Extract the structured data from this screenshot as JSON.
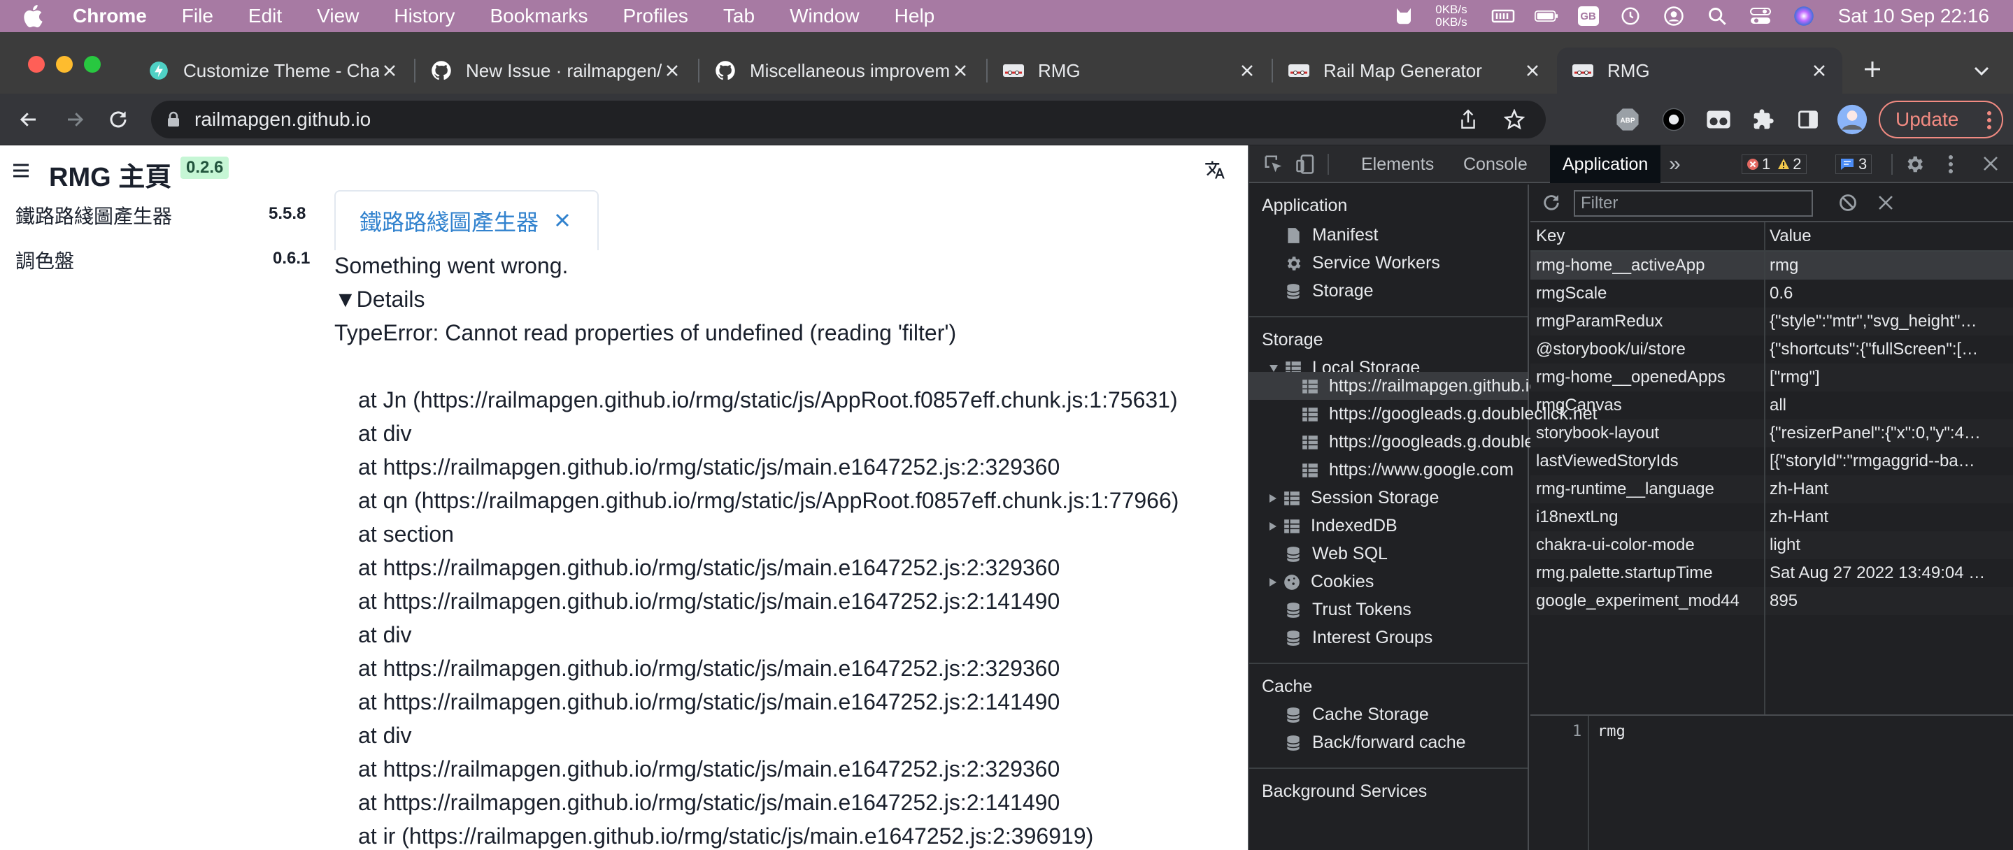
{
  "menubar": {
    "app": "Chrome",
    "items": [
      "File",
      "Edit",
      "View",
      "History",
      "Bookmarks",
      "Profiles",
      "Tab",
      "Window",
      "Help"
    ],
    "net_up": "0KB/s",
    "net_down": "0KB/s",
    "input_source": "GB",
    "clock": "Sat 10 Sep  22:16"
  },
  "tabs": [
    {
      "title": "Customize Theme - Chakra",
      "favicon": "chakra-icon"
    },
    {
      "title": "New Issue · railmapgen/rmg",
      "favicon": "github-icon"
    },
    {
      "title": "Miscellaneous improvements",
      "favicon": "github-icon"
    },
    {
      "title": "RMG",
      "favicon": "rmg-icon"
    },
    {
      "title": "Rail Map Generator",
      "favicon": "rmg-icon"
    },
    {
      "title": "RMG",
      "favicon": "rmg-icon"
    }
  ],
  "toolbar": {
    "url": "railmapgen.github.io",
    "update_label": "Update"
  },
  "app": {
    "title": "RMG 主頁",
    "version": "0.2.6",
    "nav": [
      {
        "label": "鐵路路綫圖產生器",
        "version": "5.5.8"
      },
      {
        "label": "調色盤",
        "version": "0.6.1"
      }
    ],
    "open_tab": "鐵路路綫圖產生器",
    "error_title": "Something went wrong.",
    "details_label": "▼Details",
    "error_message": "TypeError: Cannot read properties of undefined (reading 'filter')",
    "stack": [
      "at Jn (https://railmapgen.github.io/rmg/static/js/AppRoot.f0857eff.chunk.js:1:75631)",
      "at div",
      "at https://railmapgen.github.io/rmg/static/js/main.e1647252.js:2:329360",
      "at qn (https://railmapgen.github.io/rmg/static/js/AppRoot.f0857eff.chunk.js:1:77966)",
      "at section",
      "at https://railmapgen.github.io/rmg/static/js/main.e1647252.js:2:329360",
      "at https://railmapgen.github.io/rmg/static/js/main.e1647252.js:2:141490",
      "at div",
      "at https://railmapgen.github.io/rmg/static/js/main.e1647252.js:2:329360",
      "at https://railmapgen.github.io/rmg/static/js/main.e1647252.js:2:141490",
      "at div",
      "at https://railmapgen.github.io/rmg/static/js/main.e1647252.js:2:329360",
      "at https://railmapgen.github.io/rmg/static/js/main.e1647252.js:2:141490",
      "at ir (https://railmapgen.github.io/rmg/static/js/main.e1647252.js:2:396919)"
    ]
  },
  "devtools": {
    "tabs": [
      "Elements",
      "Console",
      "Application"
    ],
    "active_tab": "Application",
    "errors": "1",
    "warnings": "2",
    "messages": "3",
    "sidebar": {
      "application_header": "Application",
      "application_items": [
        "Manifest",
        "Service Workers",
        "Storage"
      ],
      "storage_header": "Storage",
      "local_storage": "Local Storage",
      "origins": [
        "https://railmapgen.github.io",
        "https://googleads.g.doubleclick.net",
        "https://googleads.g.doubleclick.net",
        "https://www.google.com"
      ],
      "storage_items": [
        "Session Storage",
        "IndexedDB",
        "Web SQL",
        "Cookies",
        "Trust Tokens",
        "Interest Groups"
      ],
      "cache_header": "Cache",
      "cache_items": [
        "Cache Storage",
        "Back/forward cache"
      ],
      "bg_header": "Background Services"
    },
    "filter_placeholder": "Filter",
    "col_key": "Key",
    "col_value": "Value",
    "rows": [
      {
        "key": "rmg-home__activeApp",
        "value": "rmg"
      },
      {
        "key": "rmgScale",
        "value": "0.6"
      },
      {
        "key": "rmgParamRedux",
        "value": "{\"style\":\"mtr\",\"svg_height\"…"
      },
      {
        "key": "@storybook/ui/store",
        "value": "{\"shortcuts\":{\"fullScreen\":[…"
      },
      {
        "key": "rmg-home__openedApps",
        "value": "[\"rmg\"]"
      },
      {
        "key": "rmgCanvas",
        "value": "all"
      },
      {
        "key": "storybook-layout",
        "value": "{\"resizerPanel\":{\"x\":0,\"y\":4…"
      },
      {
        "key": "lastViewedStoryIds",
        "value": "[{\"storyId\":\"rmgaggrid--ba…"
      },
      {
        "key": "rmg-runtime__language",
        "value": "zh-Hant"
      },
      {
        "key": "i18nextLng",
        "value": "zh-Hant"
      },
      {
        "key": "chakra-ui-color-mode",
        "value": "light"
      },
      {
        "key": "rmg.palette.startupTime",
        "value": "Sat Aug 27 2022 13:49:04 …"
      },
      {
        "key": "google_experiment_mod44",
        "value": "895"
      }
    ],
    "preview_line": "1",
    "preview_value": "rmg"
  }
}
